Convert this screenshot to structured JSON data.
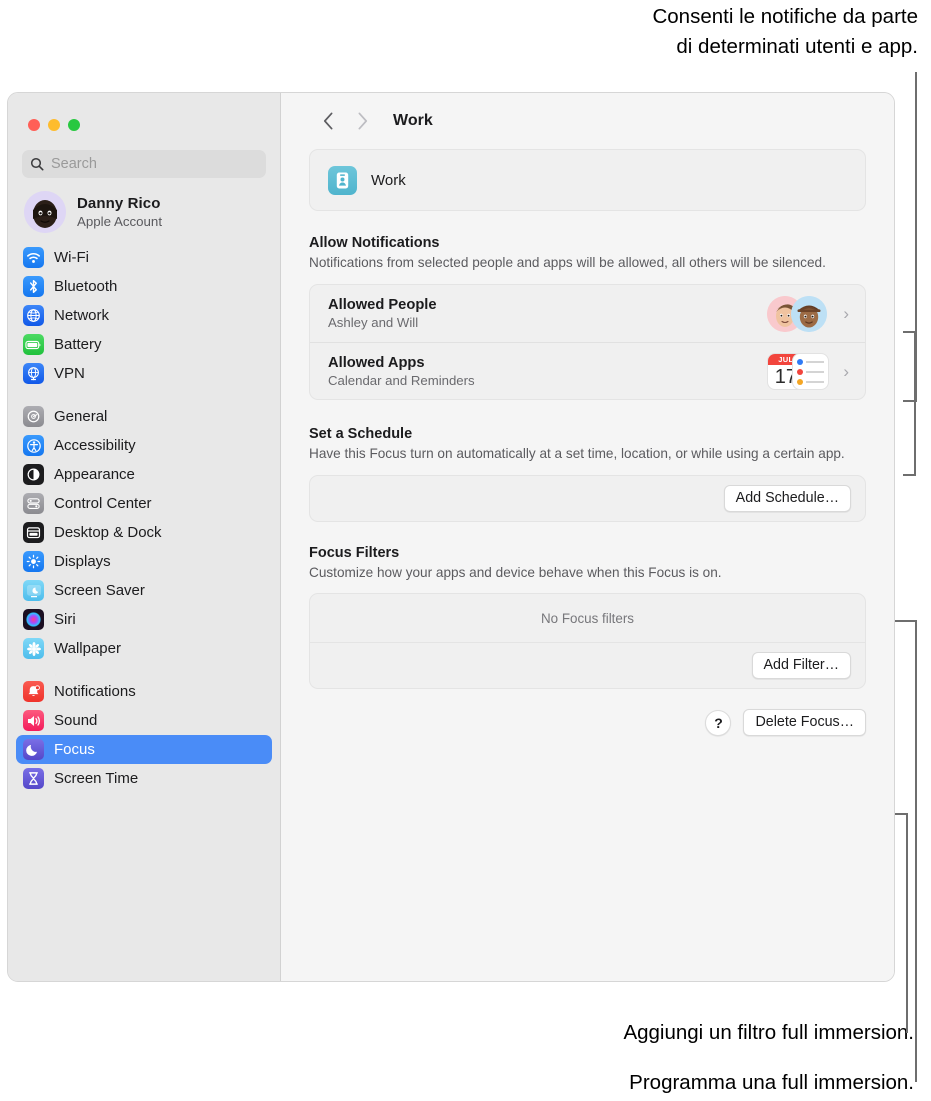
{
  "callouts": {
    "top": "Consenti le notifiche da parte\ndi determinati utenti e app.",
    "filter": "Aggiungi un filtro full immersion.",
    "schedule": "Programma una full immersion."
  },
  "window": {
    "traffic_lights": {
      "close_color": "#ff5f57",
      "minimize_color": "#febc2e",
      "zoom_color": "#28c840"
    }
  },
  "sidebar": {
    "search": {
      "placeholder": "Search",
      "value": ""
    },
    "account": {
      "name": "Danny Rico",
      "subtitle": "Apple Account"
    },
    "groups": [
      {
        "items": [
          {
            "label": "Wi-Fi",
            "icon": "wifi-icon",
            "color": "#1a84f5"
          },
          {
            "label": "Bluetooth",
            "icon": "bluetooth-icon",
            "color": "#1a84f5"
          },
          {
            "label": "Network",
            "icon": "globe-icon",
            "color": "#1a6df5"
          },
          {
            "label": "Battery",
            "icon": "battery-icon",
            "color": "#31c94c"
          },
          {
            "label": "VPN",
            "icon": "vpn-globe-icon",
            "color": "#1a6df5"
          }
        ]
      },
      {
        "items": [
          {
            "label": "General",
            "icon": "gear-icon",
            "color": "#8e8e93"
          },
          {
            "label": "Accessibility",
            "icon": "accessibility-icon",
            "color": "#1a84f5"
          },
          {
            "label": "Appearance",
            "icon": "appearance-icon",
            "color": "#1c1c1e"
          },
          {
            "label": "Control Center",
            "icon": "control-center-icon",
            "color": "#8e8e93"
          },
          {
            "label": "Desktop & Dock",
            "icon": "desktop-dock-icon",
            "color": "#1c1c1e"
          },
          {
            "label": "Displays",
            "icon": "displays-icon",
            "color": "#1a84f5"
          },
          {
            "label": "Screen Saver",
            "icon": "screen-saver-icon",
            "color": "#63cdf2"
          },
          {
            "label": "Siri",
            "icon": "siri-icon",
            "color": "#26122e"
          },
          {
            "label": "Wallpaper",
            "icon": "wallpaper-icon",
            "color": "#63cdf2"
          }
        ]
      },
      {
        "items": [
          {
            "label": "Notifications",
            "icon": "bell-icon",
            "color": "#f4453c"
          },
          {
            "label": "Sound",
            "icon": "speaker-icon",
            "color": "#f9376a"
          },
          {
            "label": "Focus",
            "icon": "moon-icon",
            "color": "#6257d6",
            "selected": true
          },
          {
            "label": "Screen Time",
            "icon": "hourglass-icon",
            "color": "#6257d6"
          }
        ]
      }
    ],
    "selected_color": "#4a8cf7"
  },
  "main": {
    "toolbar": {
      "back_icon": "chevron-left-icon",
      "forward_icon": "chevron-right-icon",
      "title": "Work"
    },
    "focus_header": {
      "name": "Work",
      "icon": "work-badge-icon",
      "icon_color": "#4fb4cd"
    },
    "allow_notifications": {
      "title": "Allow Notifications",
      "description": "Notifications from selected people and apps will be allowed, all others will be silenced.",
      "rows": [
        {
          "title": "Allowed People",
          "subtitle": "Ashley and Will",
          "accessory": "people-avatars",
          "chevron": "›"
        },
        {
          "title": "Allowed Apps",
          "subtitle": "Calendar and Reminders",
          "accessory": "app-icons",
          "chevron": "›"
        }
      ]
    },
    "schedule": {
      "title": "Set a Schedule",
      "description": "Have this Focus turn on automatically at a set time, location, or while using a certain app.",
      "add_button": "Add Schedule…"
    },
    "filters": {
      "title": "Focus Filters",
      "description": "Customize how your apps and device behave when this Focus is on.",
      "empty_text": "No Focus filters",
      "add_button": "Add Filter…"
    },
    "bottom": {
      "help_label": "?",
      "delete_button": "Delete Focus…"
    },
    "calendar_icon": {
      "month": "JUL",
      "day": "17"
    }
  }
}
